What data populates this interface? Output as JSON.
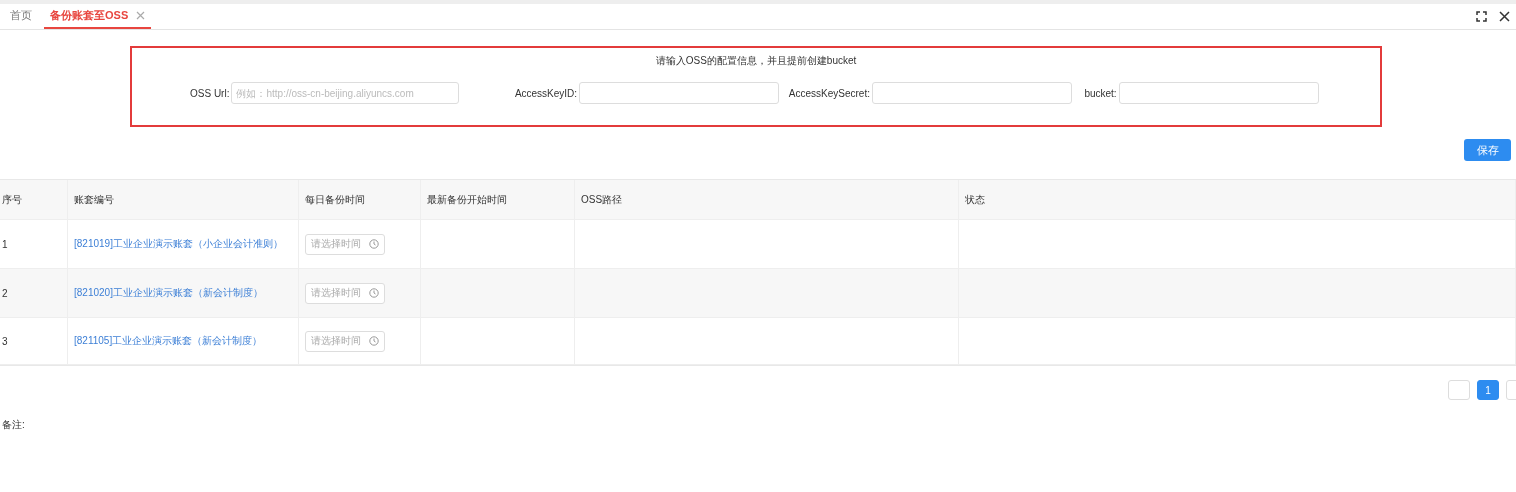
{
  "tabs": [
    {
      "label": "首页",
      "selected": false,
      "closable": false
    },
    {
      "label": "备份账套至OSS",
      "selected": true,
      "closable": true
    }
  ],
  "config": {
    "hint": "请输入OSS的配置信息，并且提前创建bucket",
    "fields": [
      {
        "label": "OSS Url:",
        "placeholder": "例如：http://oss-cn-beijing.aliyuncs.com"
      },
      {
        "label": "AccessKeyID:"
      },
      {
        "label": "AccessKeySecret:"
      },
      {
        "label": "bucket:"
      }
    ]
  },
  "save_button": "保存",
  "table": {
    "columns": [
      "序号",
      "账套编号",
      "每日备份时间",
      "最新备份开始时间",
      "OSS路径",
      "状态"
    ],
    "rows": [
      {
        "index": "1",
        "account": "[821019]工业企业演示账套（小企业会计准则）",
        "time_placeholder": "请选择时间"
      },
      {
        "index": "2",
        "account": "[821020]工业企业演示账套（新会计制度）",
        "time_placeholder": "请选择时间"
      },
      {
        "index": "3",
        "account": "[821105]工业企业演示账套（新会计制度）",
        "time_placeholder": "请选择时间"
      }
    ]
  },
  "pagination": {
    "pages": [
      {
        "label": "1",
        "selected": true
      }
    ]
  },
  "remarks_label": "备注:"
}
